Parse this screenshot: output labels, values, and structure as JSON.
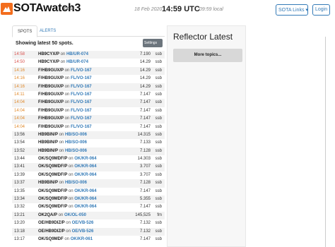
{
  "header": {
    "brand": "SOTAwatch3",
    "beta": "beta",
    "date": "18 Feb 2020",
    "time": "14:59 UTC",
    "local": "09:59 local",
    "links_button": "SOTA Links ▾",
    "login_button": "Login"
  },
  "tabs": [
    {
      "label": "SPOTS",
      "active": true
    },
    {
      "label": "ALERTS",
      "active": false
    }
  ],
  "spots_panel": {
    "showing": "Showing latest 50 spots.",
    "settings_button": "Settings",
    "on_word": "on",
    "spots": [
      {
        "time": "14:58",
        "callsign": "HB9CYX/P",
        "summit": "HB/UR-074",
        "freq": "7.190",
        "mode": "ssb",
        "time_color": "#d9534f"
      },
      {
        "time": "14:50",
        "callsign": "HB9CYX/P",
        "summit": "HB/UR-074",
        "freq": "14.29",
        "mode": "ssb",
        "time_color": "#d9534f"
      },
      {
        "time": "14:16",
        "callsign": "F/HB9GUX/P",
        "summit": "FL/VO-167",
        "freq": "14.29",
        "mode": "ssb",
        "time_color": "#e08a2c"
      },
      {
        "time": "14:16",
        "callsign": "F/HB9GUX/P",
        "summit": "FL/VO-167",
        "freq": "14.29",
        "mode": "ssb",
        "time_color": "#e08a2c"
      },
      {
        "time": "14:16",
        "callsign": "F/HB9GUX/P",
        "summit": "FL/VO-167",
        "freq": "14.29",
        "mode": "ssb",
        "time_color": "#e08a2c"
      },
      {
        "time": "14:11",
        "callsign": "F/HB9GUX/P",
        "summit": "FL/VO-167",
        "freq": "7.147",
        "mode": "ssb",
        "time_color": "#e08a2c"
      },
      {
        "time": "14:04",
        "callsign": "F/HB9GUX/P",
        "summit": "FL/VO-167",
        "freq": "7.147",
        "mode": "ssb",
        "time_color": "#e08a2c"
      },
      {
        "time": "14:04",
        "callsign": "F/HB9GUX/P",
        "summit": "FL/VO-167",
        "freq": "7.147",
        "mode": "ssb",
        "time_color": "#e08a2c"
      },
      {
        "time": "14:04",
        "callsign": "F/HB9GUX/P",
        "summit": "FL/VO-167",
        "freq": "7.147",
        "mode": "ssb",
        "time_color": "#e08a2c"
      },
      {
        "time": "14:04",
        "callsign": "F/HB9GUX/P",
        "summit": "FL/VO-167",
        "freq": "7.147",
        "mode": "ssb",
        "time_color": "#e08a2c"
      },
      {
        "time": "13:56",
        "callsign": "HB9BIN/P",
        "summit": "HB/SO-006",
        "freq": "14.315",
        "mode": "ssb",
        "time_color": "#333333"
      },
      {
        "time": "13:54",
        "callsign": "HB9BIN/P",
        "summit": "HB/SO-006",
        "freq": "7.133",
        "mode": "ssb",
        "time_color": "#333333"
      },
      {
        "time": "13:52",
        "callsign": "HB9BIN/P",
        "summit": "HB/SO-006",
        "freq": "7.128",
        "mode": "ssb",
        "time_color": "#333333"
      },
      {
        "time": "13:44",
        "callsign": "OK/SQ9MDF/P",
        "summit": "OK/KR-064",
        "freq": "14.303",
        "mode": "ssb",
        "time_color": "#333333"
      },
      {
        "time": "13:41",
        "callsign": "OK/SQ9MDF/P",
        "summit": "OK/KR-064",
        "freq": "3.707",
        "mode": "ssb",
        "time_color": "#333333"
      },
      {
        "time": "13:39",
        "callsign": "OK/SQ9MDF/P",
        "summit": "OK/KR-064",
        "freq": "3.707",
        "mode": "ssb",
        "time_color": "#333333"
      },
      {
        "time": "13:37",
        "callsign": "HB9BIN/P",
        "summit": "HB/SO-006",
        "freq": "7.128",
        "mode": "ssb",
        "time_color": "#333333"
      },
      {
        "time": "13:35",
        "callsign": "OK/SQ9MDF/P",
        "summit": "OK/KR-064",
        "freq": "7.147",
        "mode": "ssb",
        "time_color": "#333333"
      },
      {
        "time": "13:34",
        "callsign": "OK/SQ9MDF/P",
        "summit": "OK/KR-064",
        "freq": "5.355",
        "mode": "ssb",
        "time_color": "#333333"
      },
      {
        "time": "13:32",
        "callsign": "OK/SQ9MDF/P",
        "summit": "OK/KR-064",
        "freq": "7.147",
        "mode": "ssb",
        "time_color": "#333333"
      },
      {
        "time": "13:21",
        "callsign": "OK2QA/P",
        "summit": "OK/OL-050",
        "freq": "145,525",
        "mode": "fm",
        "time_color": "#333333"
      },
      {
        "time": "13:20",
        "callsign": "OE/HB9DIZ/P",
        "summit": "OE/VB-526",
        "freq": "7.132",
        "mode": "ssb",
        "time_color": "#333333"
      },
      {
        "time": "13:18",
        "callsign": "OE/HB9DIZ/P",
        "summit": "OE/VB-526",
        "freq": "7.132",
        "mode": "ssb",
        "time_color": "#333333"
      },
      {
        "time": "13:17",
        "callsign": "OK/SQ9MDF",
        "summit": "OK/KR-061",
        "freq": "7.147",
        "mode": "ssb",
        "time_color": "#333333"
      }
    ]
  },
  "reflector": {
    "title": "Reflector Latest",
    "more_button": "More topics..."
  },
  "colors": {
    "accent": "#337ab7",
    "brand": "#f36d1d",
    "recent": "#d9534f",
    "older": "#e08a2c"
  }
}
